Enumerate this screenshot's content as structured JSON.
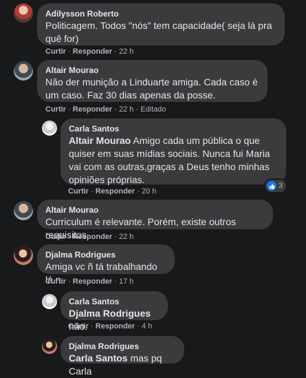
{
  "comments": [
    {
      "author": "Adilysson Roberto",
      "text": "Politicagem. Todos \"nós\" tem capacidade( seja lá pra quê for)",
      "like": "Curtir",
      "reply": "Responder",
      "time": "22 h"
    },
    {
      "author": "Altair Mourao",
      "text": "Não der munição a Linduarte amiga. Cada caso é um caso. Faz 30 dias apenas da posse.",
      "like": "Curtir",
      "reply": "Responder",
      "time": "22 h",
      "edited": "Editado"
    },
    {
      "author": "Carla Santos",
      "mention": "Altair Mourao",
      "text": "Amigo cada um pública o que quiser em suas mídias sociais. Nunca fui Maria vai com as outras,graças a Deus tenho minhas opiniões próprias.",
      "like": "Curtir",
      "reply": "Responder",
      "time": "20 h",
      "reaction_count": "3"
    },
    {
      "author": "Altair Mourao",
      "text": "Curriculum é relevante. Porém, existe outros requisitos.",
      "like": "Curtir",
      "reply": "Responder",
      "time": "22 h"
    },
    {
      "author": "Djalma Rodrigues",
      "text": "Amiga vc ñ tá trabalhando lá n",
      "like": "Curtir",
      "reply": "Responder",
      "time": "17 h"
    },
    {
      "author": "Carla Santos",
      "mention": "Djalma Rodrigues",
      "text": "não.",
      "like": "Curtir",
      "reply": "Responder",
      "time": "4 h"
    },
    {
      "author": "Djalma Rodrigues",
      "mention": "Carla Santos",
      "text": "mas pq Carla"
    }
  ],
  "separator": "·"
}
